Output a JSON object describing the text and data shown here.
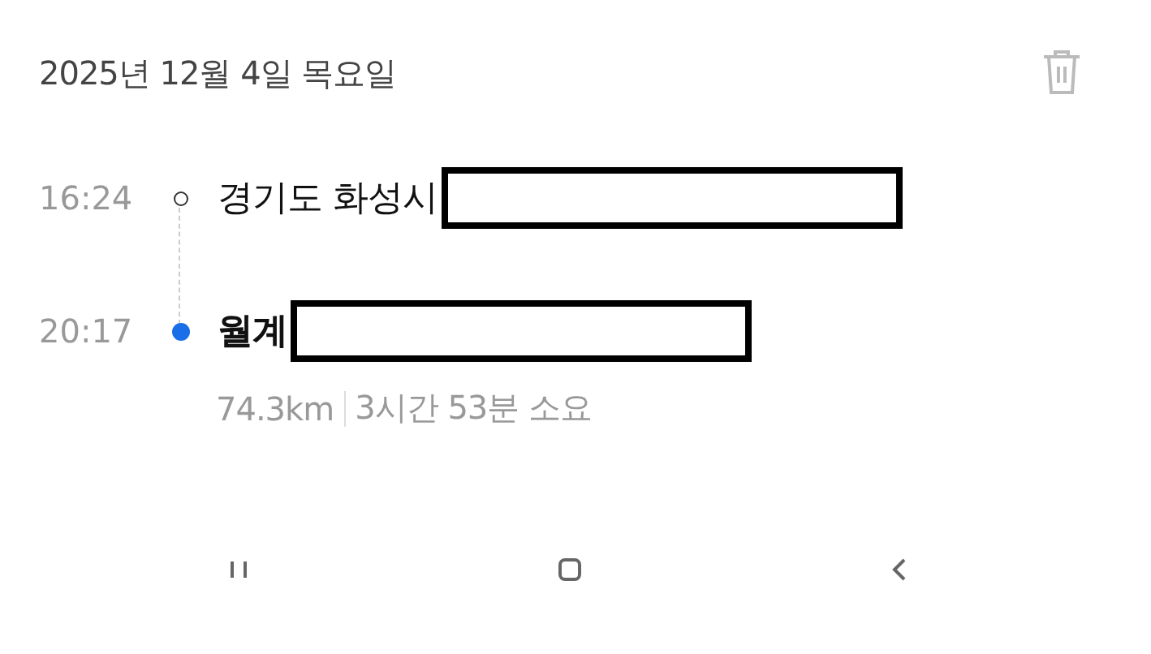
{
  "date": "2025년 12월 4일 목요일",
  "stops": [
    {
      "time": "16:24",
      "place": "경기도 화성시",
      "kind": "origin",
      "redacted": true
    },
    {
      "time": "20:17",
      "place": "월계",
      "kind": "destination",
      "redacted": true
    }
  ],
  "summary": {
    "distance": "74.3km",
    "duration": "3시간 53분 소요"
  }
}
